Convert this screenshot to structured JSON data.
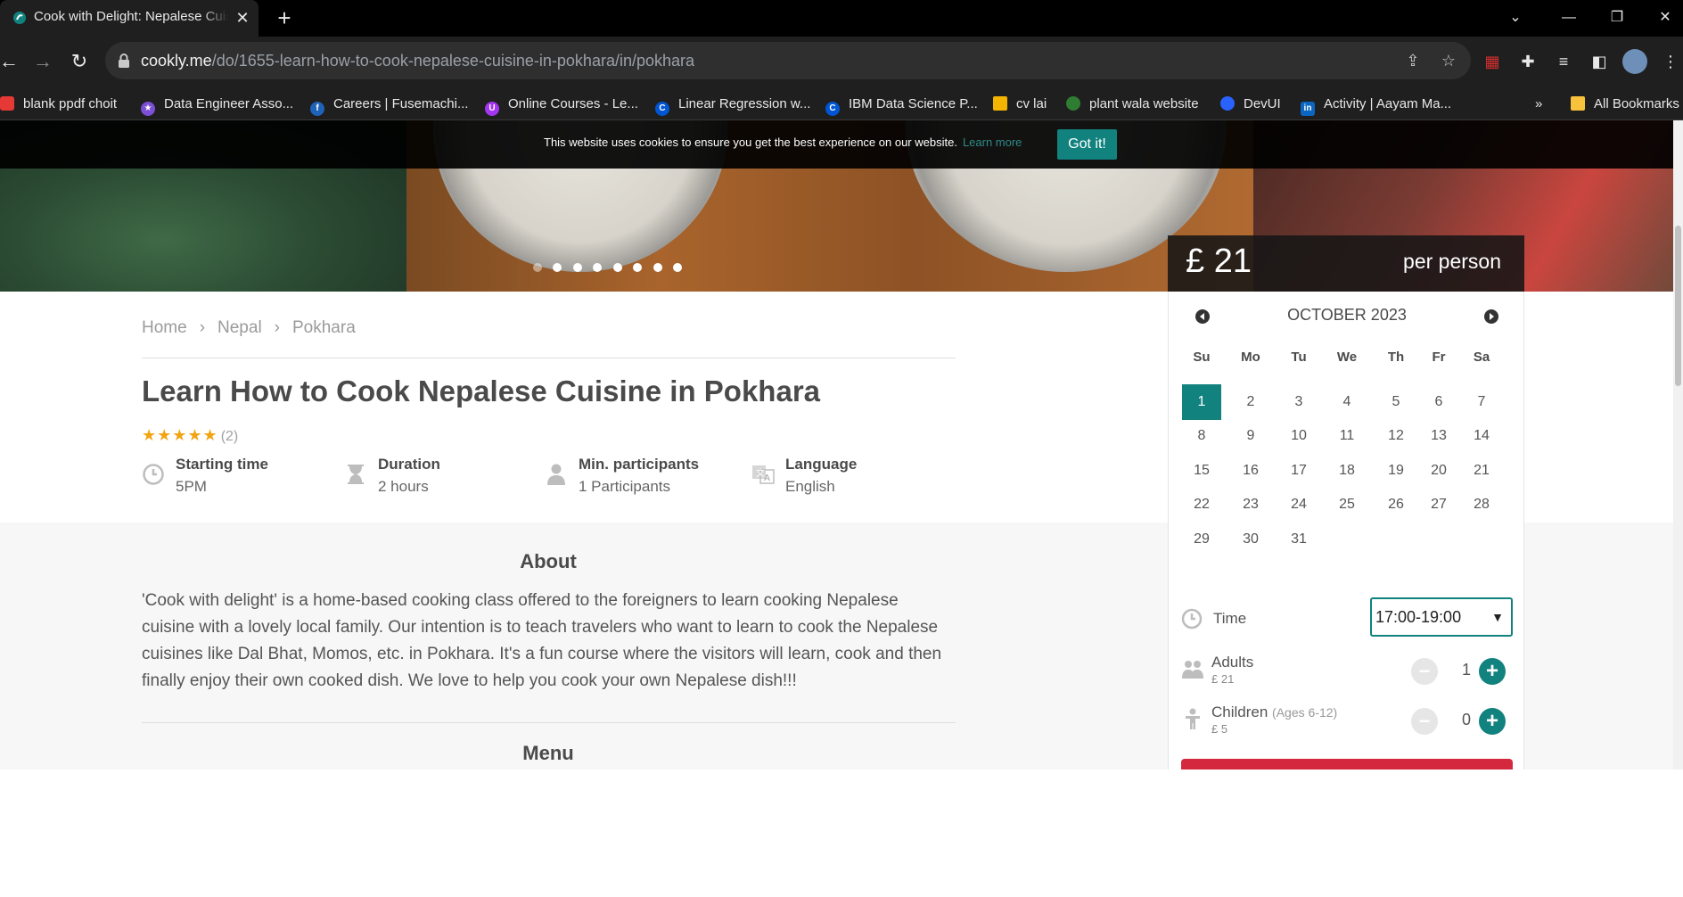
{
  "browser": {
    "tab_title": "Cook with Delight: Nepalese Cuisine",
    "url_host": "cookly.me",
    "url_path": "/do/1655-learn-how-to-cook-nepalese-cuisine-in-pokhara/in/pokhara",
    "bookmarks": [
      {
        "label": "blank ppdf choit",
        "icon": "heart-icon",
        "color": "#e53935"
      },
      {
        "label": "Data Engineer Asso...",
        "icon": "star-icon",
        "color": "#7b4fd6"
      },
      {
        "label": "Careers | Fusemachi...",
        "icon": "fusemachines-icon",
        "color": "#1e63b8"
      },
      {
        "label": "Online Courses - Le...",
        "icon": "udemy-icon",
        "color": "#a435f0"
      },
      {
        "label": "Linear Regression w...",
        "icon": "coursera-icon",
        "color": "#0056d2"
      },
      {
        "label": "IBM Data Science P...",
        "icon": "coursera-icon",
        "color": "#0056d2"
      },
      {
        "label": "cv lai",
        "icon": "google-drive-icon",
        "color": "#f4b400"
      },
      {
        "label": "plant wala website",
        "icon": "leaf-icon",
        "color": "#2e7d32"
      },
      {
        "label": "DevUI",
        "icon": "devui-icon",
        "color": "#2962ff"
      },
      {
        "label": "Activity | Aayam Ma...",
        "icon": "linkedin-icon",
        "color": "#0a66c2"
      }
    ],
    "overflow": "»",
    "all_bookmarks": "All Bookmarks"
  },
  "cookie": {
    "text": "This website uses cookies to ensure you get the best experience on our website.",
    "learn_more": "Learn more",
    "button": "Got it!"
  },
  "price": {
    "value": "£ 21",
    "unit": "per person"
  },
  "breadcrumb": [
    "Home",
    "Nepal",
    "Pokhara"
  ],
  "title": "Learn How to Cook Nepalese Cuisine in Pokhara",
  "rating": {
    "stars": "★★★★★",
    "stars_value": 5,
    "count": "(2)"
  },
  "facts": [
    {
      "label": "Starting time",
      "value": "5PM",
      "icon": "clock-icon"
    },
    {
      "label": "Duration",
      "value": "2 hours",
      "icon": "hourglass-icon"
    },
    {
      "label": "Min. participants",
      "value": "1 Participants",
      "icon": "person-icon"
    },
    {
      "label": "Language",
      "value": "English",
      "icon": "translate-icon"
    }
  ],
  "about": {
    "heading": "About",
    "text": "'Cook with delight' is a home-based cooking class offered to the foreigners to learn cooking Nepalese cuisine with a lovely local family. Our intention is to teach travelers who want to learn to cook the Nepalese cuisines like Dal Bhat, Momos, etc. in Pokhara. It's a fun course where the visitors will learn, cook and then finally enjoy their own cooked dish. We love to help you cook your own Nepalese dish!!!"
  },
  "menu_heading": "Menu",
  "calendar": {
    "month": "OCTOBER 2023",
    "weekdays": [
      "Su",
      "Mo",
      "Tu",
      "We",
      "Th",
      "Fr",
      "Sa"
    ],
    "days": [
      [
        "1",
        "2",
        "3",
        "4",
        "5",
        "6",
        "7"
      ],
      [
        "8",
        "9",
        "10",
        "11",
        "12",
        "13",
        "14"
      ],
      [
        "15",
        "16",
        "17",
        "18",
        "19",
        "20",
        "21"
      ],
      [
        "22",
        "23",
        "24",
        "25",
        "26",
        "27",
        "28"
      ],
      [
        "29",
        "30",
        "31",
        "",
        "",
        "",
        ""
      ]
    ],
    "selected": "1"
  },
  "booking": {
    "time_label": "Time",
    "time_value": "17:00-19:00",
    "adults_label": "Adults",
    "adults_price": "£ 21",
    "adults_count": "1",
    "children_label": "Children",
    "children_ages": "(Ages 6-12)",
    "children_price": "£ 5",
    "children_count": "0",
    "minus": "−",
    "plus": "+"
  },
  "slider": {
    "dot_count": 8,
    "active_index": 0
  },
  "colors": {
    "accent": "#12827f",
    "book_button": "#d4283f",
    "star": "#f2a413"
  }
}
